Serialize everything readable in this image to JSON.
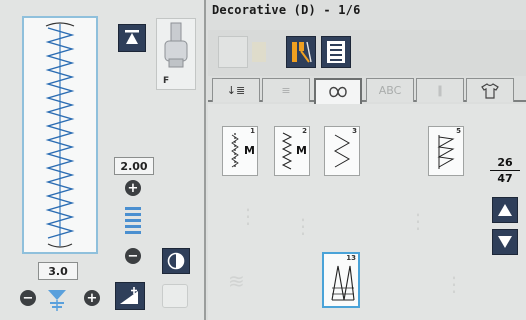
{
  "header": {
    "menu_title": "Decorative (D) - 1/6"
  },
  "left_panel": {
    "presser_foot_label": "F",
    "stitch_width_value": "2.00",
    "stitch_length_value": "3.0"
  },
  "tabs": [
    {
      "name": "straight",
      "glyph": "↓≣",
      "faded": false
    },
    {
      "name": "buttonhole",
      "glyph": "≡",
      "faded": true
    },
    {
      "name": "decorative",
      "glyph": "∞",
      "faded": false,
      "active": true
    },
    {
      "name": "alphabet",
      "glyph": "ABC",
      "faded": true
    },
    {
      "name": "quilt",
      "glyph": "∥",
      "faded": true
    },
    {
      "name": "garment",
      "glyph": "†",
      "faded": false
    }
  ],
  "stitches": [
    {
      "number": "1",
      "label": "M"
    },
    {
      "number": "2",
      "label": "M"
    },
    {
      "number": "3",
      "label": ""
    },
    {
      "number": "5",
      "label": ""
    },
    {
      "number": "13",
      "label": ""
    }
  ],
  "pagination": {
    "current": "26",
    "total": "47"
  },
  "icons": {
    "needle_up": "needle-up-icon",
    "mirror": "mirror-icon",
    "needle_position": "needle-position-icon",
    "stitch_mode": "stitch-mode-icon",
    "menu_list": "menu-list-icon",
    "page_up": "triangle-up-icon",
    "page_down": "triangle-down-icon"
  },
  "colors": {
    "dark_button": "#2f3f5a",
    "selection_blue": "#4aa3d8",
    "accent_orange": "#f0a020"
  }
}
